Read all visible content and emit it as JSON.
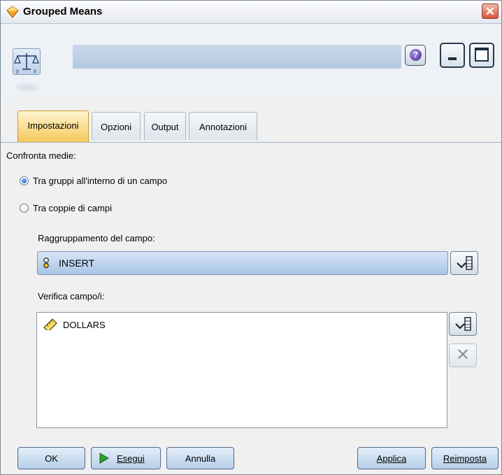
{
  "window": {
    "title": "Grouped Means",
    "close_glyph": "✕"
  },
  "toolbar": {
    "help_glyph": "?"
  },
  "tabs": [
    {
      "label": "Impostazioni",
      "active": true
    },
    {
      "label": "Opzioni",
      "active": false
    },
    {
      "label": "Output",
      "active": false
    },
    {
      "label": "Annotazioni",
      "active": false
    }
  ],
  "settings": {
    "compare_label": "Confronta medie:",
    "option_within": "Tra gruppi all'interno di un campo",
    "option_pairs": "Tra coppie di campi",
    "selected_option": "within",
    "grouping_label": "Raggruppamento del campo:",
    "grouping_value": "INSERT",
    "test_fields_label": "Verifica campo/i:",
    "test_fields": [
      "DOLLARS"
    ]
  },
  "footer": {
    "ok": "OK",
    "run": "Esegui",
    "cancel": "Annulla",
    "apply": "Applica",
    "reset": "Reimposta"
  },
  "colors": {
    "active_tab": "#f5c95a",
    "accent_blue": "#b3c9e1"
  }
}
